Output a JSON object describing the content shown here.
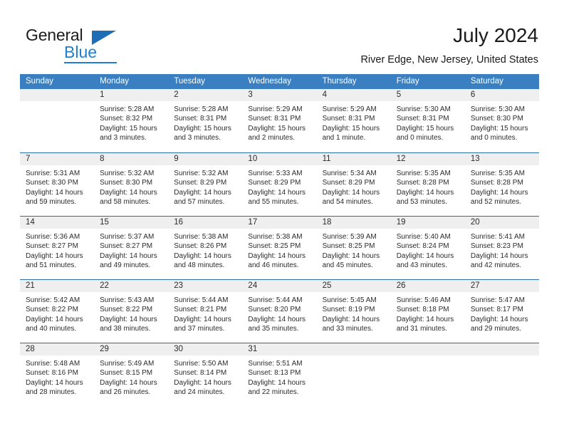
{
  "logo": {
    "general": "General",
    "blue": "Blue"
  },
  "header": {
    "title": "July 2024",
    "subtitle": "River Edge, New Jersey, United States"
  },
  "colors": {
    "header_blue": "#3a7fc1",
    "row_border_blue": "#2e6da4",
    "day_band_gray": "#efefef",
    "logo_blue": "#1f7fd0"
  },
  "weekdays": [
    "Sunday",
    "Monday",
    "Tuesday",
    "Wednesday",
    "Thursday",
    "Friday",
    "Saturday"
  ],
  "labels": {
    "sunrise_prefix": "Sunrise:",
    "sunset_prefix": "Sunset:",
    "daylight_prefix": "Daylight:"
  },
  "weeks": [
    [
      {
        "day": "",
        "sunrise": "",
        "sunset": "",
        "daylight_line1": "",
        "daylight_line2": ""
      },
      {
        "day": "1",
        "sunrise": "Sunrise: 5:28 AM",
        "sunset": "Sunset: 8:32 PM",
        "daylight_line1": "Daylight: 15 hours",
        "daylight_line2": "and 3 minutes."
      },
      {
        "day": "2",
        "sunrise": "Sunrise: 5:28 AM",
        "sunset": "Sunset: 8:31 PM",
        "daylight_line1": "Daylight: 15 hours",
        "daylight_line2": "and 3 minutes."
      },
      {
        "day": "3",
        "sunrise": "Sunrise: 5:29 AM",
        "sunset": "Sunset: 8:31 PM",
        "daylight_line1": "Daylight: 15 hours",
        "daylight_line2": "and 2 minutes."
      },
      {
        "day": "4",
        "sunrise": "Sunrise: 5:29 AM",
        "sunset": "Sunset: 8:31 PM",
        "daylight_line1": "Daylight: 15 hours",
        "daylight_line2": "and 1 minute."
      },
      {
        "day": "5",
        "sunrise": "Sunrise: 5:30 AM",
        "sunset": "Sunset: 8:31 PM",
        "daylight_line1": "Daylight: 15 hours",
        "daylight_line2": "and 0 minutes."
      },
      {
        "day": "6",
        "sunrise": "Sunrise: 5:30 AM",
        "sunset": "Sunset: 8:30 PM",
        "daylight_line1": "Daylight: 15 hours",
        "daylight_line2": "and 0 minutes."
      }
    ],
    [
      {
        "day": "7",
        "sunrise": "Sunrise: 5:31 AM",
        "sunset": "Sunset: 8:30 PM",
        "daylight_line1": "Daylight: 14 hours",
        "daylight_line2": "and 59 minutes."
      },
      {
        "day": "8",
        "sunrise": "Sunrise: 5:32 AM",
        "sunset": "Sunset: 8:30 PM",
        "daylight_line1": "Daylight: 14 hours",
        "daylight_line2": "and 58 minutes."
      },
      {
        "day": "9",
        "sunrise": "Sunrise: 5:32 AM",
        "sunset": "Sunset: 8:29 PM",
        "daylight_line1": "Daylight: 14 hours",
        "daylight_line2": "and 57 minutes."
      },
      {
        "day": "10",
        "sunrise": "Sunrise: 5:33 AM",
        "sunset": "Sunset: 8:29 PM",
        "daylight_line1": "Daylight: 14 hours",
        "daylight_line2": "and 55 minutes."
      },
      {
        "day": "11",
        "sunrise": "Sunrise: 5:34 AM",
        "sunset": "Sunset: 8:29 PM",
        "daylight_line1": "Daylight: 14 hours",
        "daylight_line2": "and 54 minutes."
      },
      {
        "day": "12",
        "sunrise": "Sunrise: 5:35 AM",
        "sunset": "Sunset: 8:28 PM",
        "daylight_line1": "Daylight: 14 hours",
        "daylight_line2": "and 53 minutes."
      },
      {
        "day": "13",
        "sunrise": "Sunrise: 5:35 AM",
        "sunset": "Sunset: 8:28 PM",
        "daylight_line1": "Daylight: 14 hours",
        "daylight_line2": "and 52 minutes."
      }
    ],
    [
      {
        "day": "14",
        "sunrise": "Sunrise: 5:36 AM",
        "sunset": "Sunset: 8:27 PM",
        "daylight_line1": "Daylight: 14 hours",
        "daylight_line2": "and 51 minutes."
      },
      {
        "day": "15",
        "sunrise": "Sunrise: 5:37 AM",
        "sunset": "Sunset: 8:27 PM",
        "daylight_line1": "Daylight: 14 hours",
        "daylight_line2": "and 49 minutes."
      },
      {
        "day": "16",
        "sunrise": "Sunrise: 5:38 AM",
        "sunset": "Sunset: 8:26 PM",
        "daylight_line1": "Daylight: 14 hours",
        "daylight_line2": "and 48 minutes."
      },
      {
        "day": "17",
        "sunrise": "Sunrise: 5:38 AM",
        "sunset": "Sunset: 8:25 PM",
        "daylight_line1": "Daylight: 14 hours",
        "daylight_line2": "and 46 minutes."
      },
      {
        "day": "18",
        "sunrise": "Sunrise: 5:39 AM",
        "sunset": "Sunset: 8:25 PM",
        "daylight_line1": "Daylight: 14 hours",
        "daylight_line2": "and 45 minutes."
      },
      {
        "day": "19",
        "sunrise": "Sunrise: 5:40 AM",
        "sunset": "Sunset: 8:24 PM",
        "daylight_line1": "Daylight: 14 hours",
        "daylight_line2": "and 43 minutes."
      },
      {
        "day": "20",
        "sunrise": "Sunrise: 5:41 AM",
        "sunset": "Sunset: 8:23 PM",
        "daylight_line1": "Daylight: 14 hours",
        "daylight_line2": "and 42 minutes."
      }
    ],
    [
      {
        "day": "21",
        "sunrise": "Sunrise: 5:42 AM",
        "sunset": "Sunset: 8:22 PM",
        "daylight_line1": "Daylight: 14 hours",
        "daylight_line2": "and 40 minutes."
      },
      {
        "day": "22",
        "sunrise": "Sunrise: 5:43 AM",
        "sunset": "Sunset: 8:22 PM",
        "daylight_line1": "Daylight: 14 hours",
        "daylight_line2": "and 38 minutes."
      },
      {
        "day": "23",
        "sunrise": "Sunrise: 5:44 AM",
        "sunset": "Sunset: 8:21 PM",
        "daylight_line1": "Daylight: 14 hours",
        "daylight_line2": "and 37 minutes."
      },
      {
        "day": "24",
        "sunrise": "Sunrise: 5:44 AM",
        "sunset": "Sunset: 8:20 PM",
        "daylight_line1": "Daylight: 14 hours",
        "daylight_line2": "and 35 minutes."
      },
      {
        "day": "25",
        "sunrise": "Sunrise: 5:45 AM",
        "sunset": "Sunset: 8:19 PM",
        "daylight_line1": "Daylight: 14 hours",
        "daylight_line2": "and 33 minutes."
      },
      {
        "day": "26",
        "sunrise": "Sunrise: 5:46 AM",
        "sunset": "Sunset: 8:18 PM",
        "daylight_line1": "Daylight: 14 hours",
        "daylight_line2": "and 31 minutes."
      },
      {
        "day": "27",
        "sunrise": "Sunrise: 5:47 AM",
        "sunset": "Sunset: 8:17 PM",
        "daylight_line1": "Daylight: 14 hours",
        "daylight_line2": "and 29 minutes."
      }
    ],
    [
      {
        "day": "28",
        "sunrise": "Sunrise: 5:48 AM",
        "sunset": "Sunset: 8:16 PM",
        "daylight_line1": "Daylight: 14 hours",
        "daylight_line2": "and 28 minutes."
      },
      {
        "day": "29",
        "sunrise": "Sunrise: 5:49 AM",
        "sunset": "Sunset: 8:15 PM",
        "daylight_line1": "Daylight: 14 hours",
        "daylight_line2": "and 26 minutes."
      },
      {
        "day": "30",
        "sunrise": "Sunrise: 5:50 AM",
        "sunset": "Sunset: 8:14 PM",
        "daylight_line1": "Daylight: 14 hours",
        "daylight_line2": "and 24 minutes."
      },
      {
        "day": "31",
        "sunrise": "Sunrise: 5:51 AM",
        "sunset": "Sunset: 8:13 PM",
        "daylight_line1": "Daylight: 14 hours",
        "daylight_line2": "and 22 minutes."
      },
      {
        "day": "",
        "sunrise": "",
        "sunset": "",
        "daylight_line1": "",
        "daylight_line2": ""
      },
      {
        "day": "",
        "sunrise": "",
        "sunset": "",
        "daylight_line1": "",
        "daylight_line2": ""
      },
      {
        "day": "",
        "sunrise": "",
        "sunset": "",
        "daylight_line1": "",
        "daylight_line2": ""
      }
    ]
  ]
}
